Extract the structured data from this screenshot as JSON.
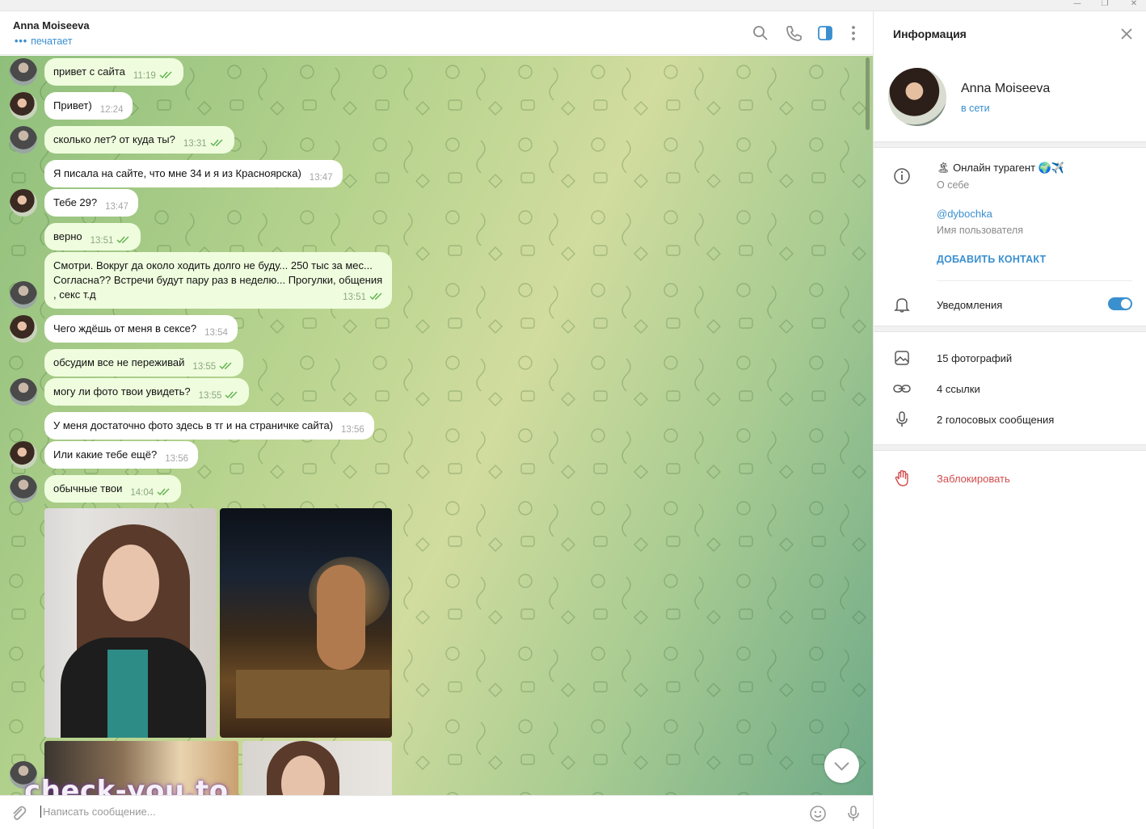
{
  "window": {
    "minimize": "—",
    "restore": "❐",
    "close": "✕"
  },
  "header": {
    "name": "Anna Moiseeva",
    "status": "печатает",
    "typing_dots": "•••"
  },
  "messages": [
    {
      "text": "привет с сайта",
      "time": "11:19",
      "outgoing": true
    },
    {
      "text": "Привет)",
      "time": "12:24",
      "outgoing": false
    },
    {
      "text": "сколько лет? от куда ты?",
      "time": "13:31",
      "outgoing": true
    },
    {
      "text": "Я писала на сайте, что мне 34 и я из Красноярска)",
      "time": "13:47",
      "outgoing": false
    },
    {
      "text": "Тебе 29?",
      "time": "13:47",
      "outgoing": false
    },
    {
      "text": "верно",
      "time": "13:51",
      "outgoing": true
    },
    {
      "text": "Смотри. Вокруг да около ходить долго не буду... 250 тыс  за мес... Согласна?? Встречи будут пару раз в неделю... Прогулки, общения , секс  т.д",
      "time": "13:51",
      "outgoing": true
    },
    {
      "text": "Чего ждёшь от меня в сексе?",
      "time": "13:54",
      "outgoing": false
    },
    {
      "text": "обсудим все не переживай",
      "time": "13:55",
      "outgoing": true
    },
    {
      "text": "могу ли фото твои увидеть?",
      "time": "13:55",
      "outgoing": true
    },
    {
      "text": "У меня достаточно фото здесь в тг и на страничке сайта)",
      "time": "13:56",
      "outgoing": false
    },
    {
      "text": "Или какие тебе ещё?",
      "time": "13:56",
      "outgoing": false
    },
    {
      "text": "обычные твои",
      "time": "14:04",
      "outgoing": true
    }
  ],
  "watermark": "check-you.to",
  "composer": {
    "placeholder": "Написать сообщение..."
  },
  "panel": {
    "title": "Информация",
    "name": "Anna Moiseeva",
    "status": "в сети",
    "bio": "Онлайн турагент",
    "bio_emoji_before": "🏝",
    "bio_emoji_after": "🌍✈️",
    "bio_label": "О себе",
    "username": "@dybochka",
    "username_label": "Имя пользователя",
    "add_contact": "ДОБАВИТЬ КОНТАКТ",
    "notifications": "Уведомления",
    "notifications_on": true,
    "photos": "15 фотографий",
    "links": "4 ссылки",
    "voice": "2 голосовых сообщения",
    "block": "Заблокировать"
  },
  "colors": {
    "accent": "#3a8fcf",
    "outgoing_bubble": "#effdde",
    "danger": "#d34b4b"
  }
}
